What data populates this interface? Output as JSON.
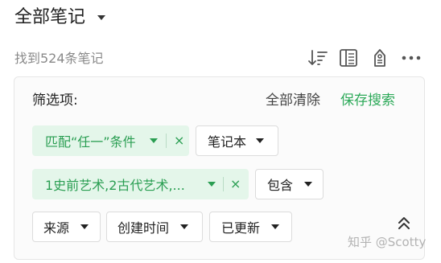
{
  "header": {
    "title": "全部笔记",
    "title_dropdown_icon": "caret-down-icon"
  },
  "toolbar": {
    "result_count": "找到524条笔记",
    "icons": [
      "sort-icon",
      "layout-icon",
      "shortcut-icon",
      "more-icon"
    ]
  },
  "filter_panel": {
    "label": "筛选项:",
    "clear_all": "全部清除",
    "save_search": "保存搜索",
    "chips": {
      "match": {
        "label": "匹配“任一”条件",
        "remove": "×"
      },
      "notebook": {
        "label": "笔记本"
      },
      "tags": {
        "label": "1史前艺术,2古代艺术,...",
        "remove": "×"
      },
      "contains": {
        "label": "包含"
      },
      "source": {
        "label": "来源"
      },
      "created": {
        "label": "创建时间"
      },
      "updated": {
        "label": "已更新"
      }
    },
    "collapse_icon": "double-chevron-up-icon"
  },
  "watermark": "知乎 @Scotty",
  "colors": {
    "accent_green": "#2eaa5a",
    "chip_green_bg": "#e4f6ea",
    "muted_text": "#8a8a8a",
    "panel_border": "#e6e6e6"
  }
}
